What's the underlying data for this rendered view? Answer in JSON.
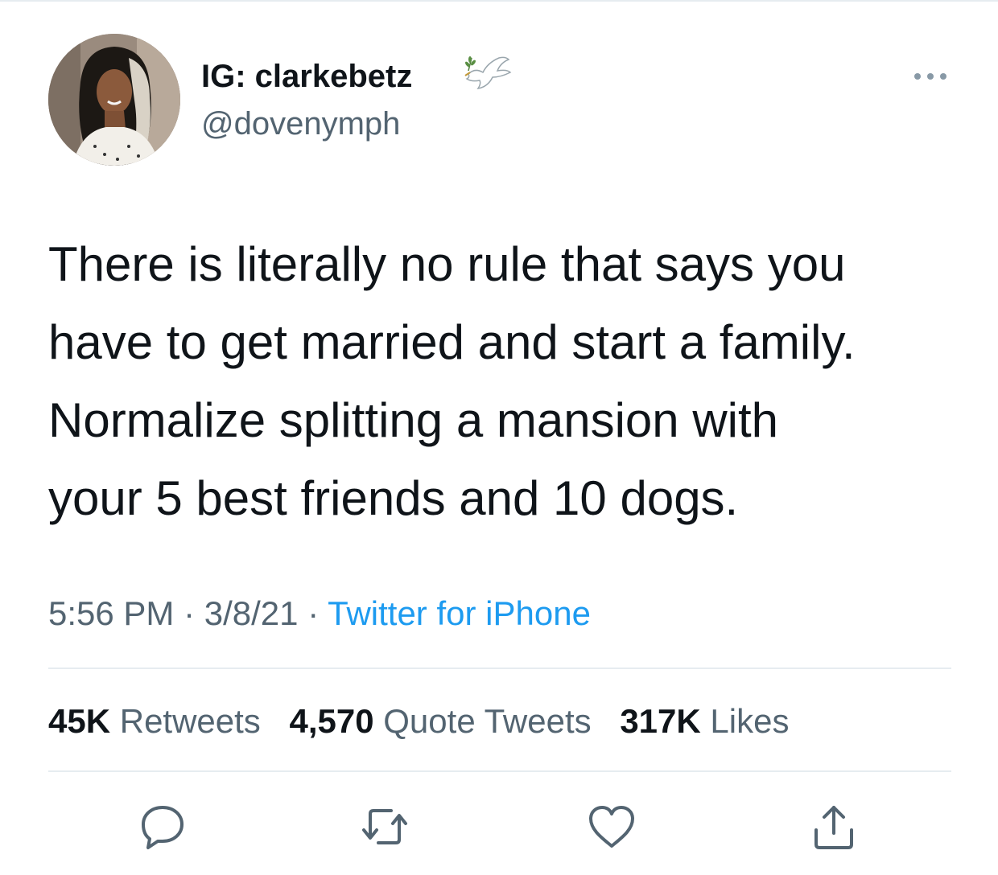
{
  "author": {
    "display_name": "IG: clarkebetz",
    "handle": "@dovenymph",
    "badge_icon": "dove-icon"
  },
  "tweet": {
    "lines": [
      "There is literally no rule that says you",
      "have to get married and start a family.",
      "Normalize splitting a mansion with",
      "your 5 best friends and 10 dogs."
    ]
  },
  "meta": {
    "time": "5:56 PM",
    "separator": " · ",
    "date": "3/8/21",
    "source": "Twitter for iPhone"
  },
  "stats": {
    "retweets_count": "45K",
    "retweets_label": "Retweets",
    "quotes_count": "4,570",
    "quotes_label": "Quote Tweets",
    "likes_count": "317K",
    "likes_label": "Likes"
  },
  "actions": [
    "reply-icon",
    "retweet-icon",
    "like-icon",
    "share-icon"
  ],
  "colors": {
    "text": "#0f1419",
    "secondary": "#536471",
    "link": "#1d9bf0",
    "divider": "#e6ecf0"
  }
}
